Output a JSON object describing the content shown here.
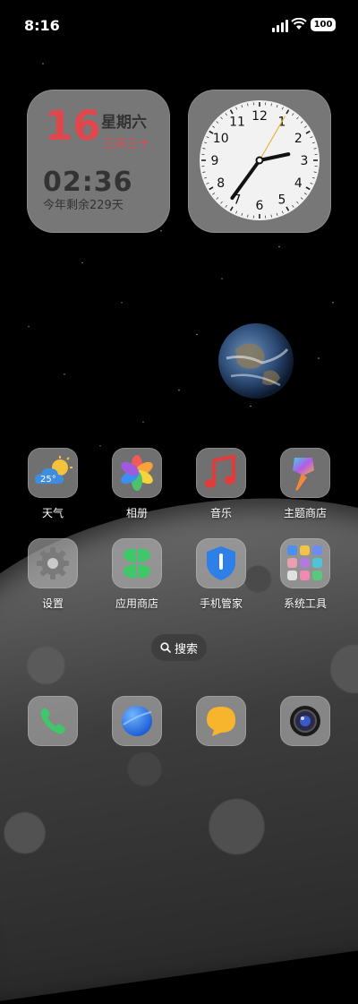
{
  "status_bar": {
    "time": "8:16",
    "battery": "100"
  },
  "date_widget": {
    "day": "16",
    "weekday": "星期六",
    "lunar": "三月三十",
    "time": "02:36",
    "remaining": "今年剩余229天"
  },
  "clock_widget": {
    "numbers": [
      "12",
      "1",
      "2",
      "3",
      "4",
      "5",
      "6",
      "7",
      "8",
      "9",
      "10",
      "11"
    ],
    "hour_hand_deg": 78,
    "minute_hand_deg": 216,
    "second_hand_deg": 30,
    "second_hand_color": "#e8b23a"
  },
  "apps_row1": [
    {
      "label": "天气",
      "icon": "weather-icon",
      "temp": "25°"
    },
    {
      "label": "相册",
      "icon": "gallery-icon"
    },
    {
      "label": "音乐",
      "icon": "music-icon"
    },
    {
      "label": "主题商店",
      "icon": "theme-store-icon"
    }
  ],
  "apps_row2": [
    {
      "label": "设置",
      "icon": "settings-icon"
    },
    {
      "label": "应用商店",
      "icon": "app-store-icon"
    },
    {
      "label": "手机管家",
      "icon": "phone-manager-icon"
    },
    {
      "label": "系统工具",
      "icon": "system-tools-folder-icon"
    }
  ],
  "search": {
    "label": "搜索"
  },
  "dock": [
    {
      "icon": "phone-icon"
    },
    {
      "icon": "browser-icon"
    },
    {
      "icon": "messages-icon"
    },
    {
      "icon": "camera-icon"
    }
  ],
  "colors": {
    "accent_red": "#e0474c",
    "tile_bg": "#b4b4b4"
  }
}
